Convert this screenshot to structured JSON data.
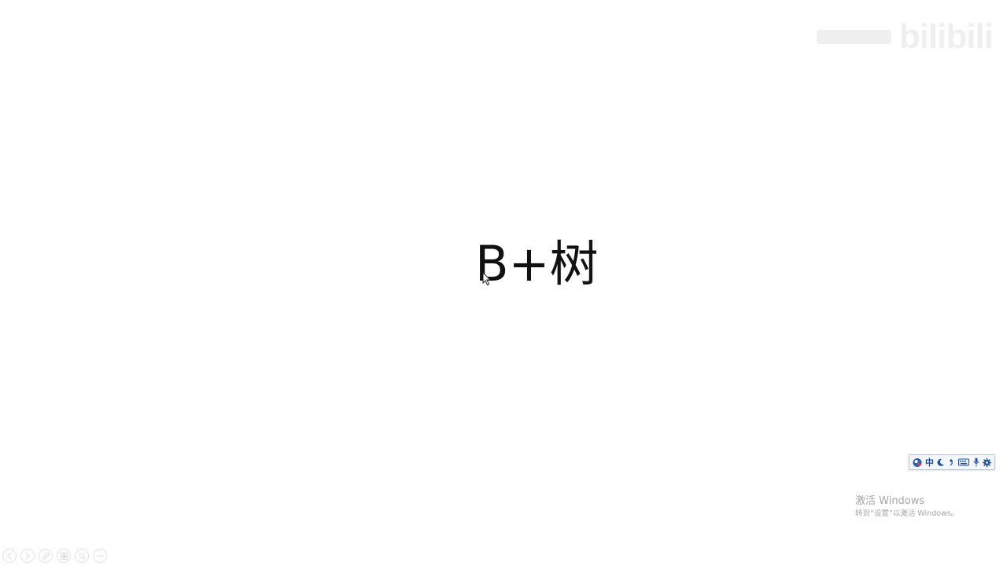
{
  "watermark": {
    "text": "bilibili"
  },
  "slide": {
    "title": "B+树"
  },
  "ime_toolbar": {
    "mode_label": "中",
    "icons": [
      "ime-logo-icon",
      "chinese-mode-icon",
      "halfwidth-moon-icon",
      "punctuation-icon",
      "soft-keyboard-icon",
      "microphone-icon",
      "settings-gear-icon"
    ]
  },
  "windows_activation": {
    "title": "激活 Windows",
    "subtitle": "转到“设置”以激活 Windows。"
  },
  "slideshow_controls": {
    "icons": [
      "previous-slide-icon",
      "next-slide-icon",
      "pen-icon",
      "slide-sorter-icon",
      "zoom-icon",
      "more-options-icon"
    ]
  }
}
